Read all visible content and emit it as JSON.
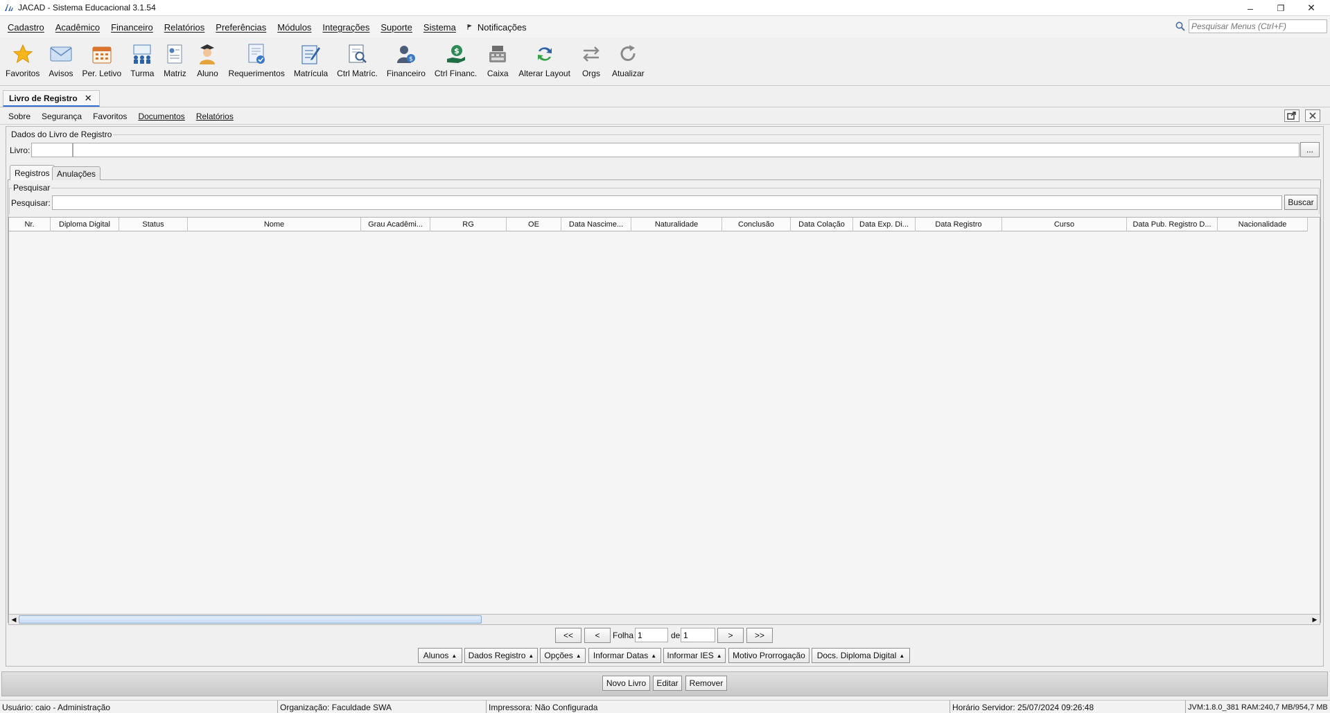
{
  "window": {
    "title": "JACAD - Sistema Educacional 3.1.54",
    "minimize": "–",
    "restore": "❐",
    "close": "✕"
  },
  "menubar": {
    "items": [
      "Cadastro",
      "Acadêmico",
      "Financeiro",
      "Relatórios",
      "Preferências",
      "Módulos",
      "Integrações",
      "Suporte",
      "Sistema"
    ],
    "notifications": "Notificações",
    "search_placeholder": "Pesquisar Menus (Ctrl+F)"
  },
  "toolbar": {
    "items": [
      "Favoritos",
      "Avisos",
      "Per. Letivo",
      "Turma",
      "Matriz",
      "Aluno",
      "Requerimentos",
      "Matrícula",
      "Ctrl Matríc.",
      "Financeiro",
      "Ctrl Financ.",
      "Caixa",
      "Alterar Layout",
      "Orgs",
      "Atualizar"
    ]
  },
  "doc_tab": {
    "label": "Livro de Registro",
    "close": "✕"
  },
  "submenu": {
    "items": [
      "Sobre",
      "Segurança",
      "Favoritos",
      "Documentos",
      "Relatórios"
    ]
  },
  "livro_group": {
    "title": "Dados do Livro de Registro",
    "livro_label": "Livro:",
    "livro_code": "",
    "livro_desc": "",
    "browse": "..."
  },
  "tabs": [
    "Registros",
    "Anulações"
  ],
  "search": {
    "group_title": "Pesquisar",
    "label": "Pesquisar:",
    "value": "",
    "button": "Buscar"
  },
  "table": {
    "columns": [
      "Nr.",
      "Diploma Digital",
      "Status",
      "Nome",
      "Grau Acadêmi...",
      "RG",
      "OE",
      "Data Nascime...",
      "Naturalidade",
      "Conclusão",
      "Data Colação",
      "Data Exp. Di...",
      "Data Registro",
      "Curso",
      "Data Pub. Registro D...",
      "Nacionalidade"
    ],
    "rows": []
  },
  "pagination": {
    "first": "<<",
    "prev": "<",
    "folha_label": "Folha",
    "folha_value": "1",
    "de_label": "de",
    "total_value": "1",
    "next": ">",
    "last": ">>"
  },
  "actions": [
    "Alunos",
    "Dados Registro",
    "Opções",
    "Informar Datas",
    "Informar IES",
    "Motivo Prorrogação",
    "Docs. Diploma Digital"
  ],
  "bottom_buttons": [
    "Novo Livro",
    "Editar",
    "Remover"
  ],
  "status": {
    "user": "Usuário: caio - Administração",
    "org": "Organização: Faculdade SWA",
    "printer": "Impressora: Não Configurada",
    "server_time": "Horário Servidor: 25/07/2024 09:26:48",
    "jvm": "JVM:1.8.0_381  RAM:240,7 MB/954,7 MB"
  }
}
